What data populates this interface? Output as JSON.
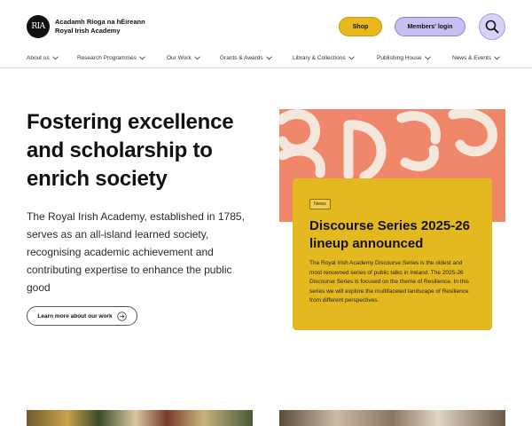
{
  "logo": {
    "mark": "RIA",
    "line1": "Acadamh Ríoga na hÉireann",
    "line2": "Royal Irish Academy"
  },
  "header": {
    "shop_label": "Shop",
    "login_label": "Members' login",
    "search_icon": "search-icon"
  },
  "nav": {
    "items": [
      {
        "label": "About us"
      },
      {
        "label": "Research Programmes"
      },
      {
        "label": "Our Work"
      },
      {
        "label": "Grants & Awards"
      },
      {
        "label": "Library & Collections"
      },
      {
        "label": "Publishing House"
      },
      {
        "label": "News & Events"
      }
    ]
  },
  "hero": {
    "title": "Fostering excellence and scholarship to enrich society",
    "body": "The Royal Irish Academy, established in 1785, serves as an all-island learned society, recognising academic achievement and contributing expertise to enhance the public good",
    "button_label": "Learn more about our work"
  },
  "feature": {
    "tag": "News",
    "title": "Discourse Series 2025-26 lineup announced",
    "body": "The Royal Irish Academy Discourse Series is the oldest and most renowned series of public talks in Ireland. The 2025-26 Discourse Series is focused on the theme of Resilience. In this series we will explore the multifaceted landscape of Resilience from different perspectives."
  },
  "colors": {
    "shop": "#e8b81d",
    "login": "#c8bff3",
    "feature_bg": "#f0866a",
    "card": "#e4b91f"
  }
}
